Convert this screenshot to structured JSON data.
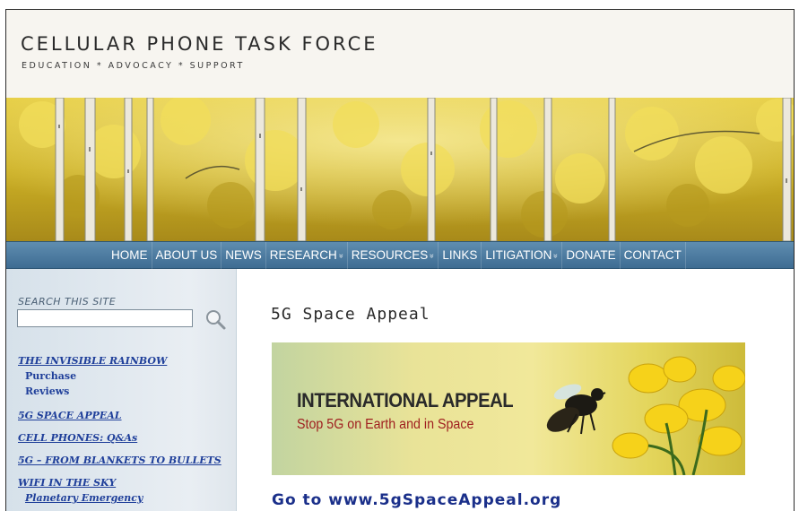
{
  "header": {
    "title": "CELLULAR PHONE TASK FORCE",
    "tagline": "EDUCATION * ADVOCACY * SUPPORT"
  },
  "nav": {
    "items": [
      {
        "label": "HOME"
      },
      {
        "label": "ABOUT US"
      },
      {
        "label": "NEWS"
      },
      {
        "label": "RESEARCH",
        "dropdown": true
      },
      {
        "label": "RESOURCES",
        "dropdown": true
      },
      {
        "label": "LINKS"
      },
      {
        "label": "LITIGATION",
        "dropdown": true
      },
      {
        "label": "DONATE"
      },
      {
        "label": "CONTACT"
      }
    ],
    "dropdown_glyph": "»"
  },
  "sidebar": {
    "search_label": "SEARCH THIS SITE",
    "search_value": "",
    "search_icon": "magnifier-icon",
    "links": {
      "invisible_rainbow": "THE INVISIBLE RAINBOW",
      "purchase": "Purchase",
      "reviews": "Reviews",
      "space_appeal": "5G SPACE APPEAL",
      "cell_phones": "CELL PHONES: Q&As",
      "blankets": "5G – FROM BLANKETS TO BULLETS",
      "wifi_sky": "WIFI IN THE SKY",
      "planetary": "Planetary Emergency"
    }
  },
  "main": {
    "page_title": "5G Space Appeal",
    "banner": {
      "heading": "INTERNATIONAL APPEAL",
      "subheading": "Stop 5G on Earth and in Space"
    },
    "goto_link": "Go to www.5gSpaceAppeal.org"
  },
  "colors": {
    "nav_bg": "#4a789e",
    "link": "#1f3f9a",
    "banner_sub": "#a02020"
  }
}
